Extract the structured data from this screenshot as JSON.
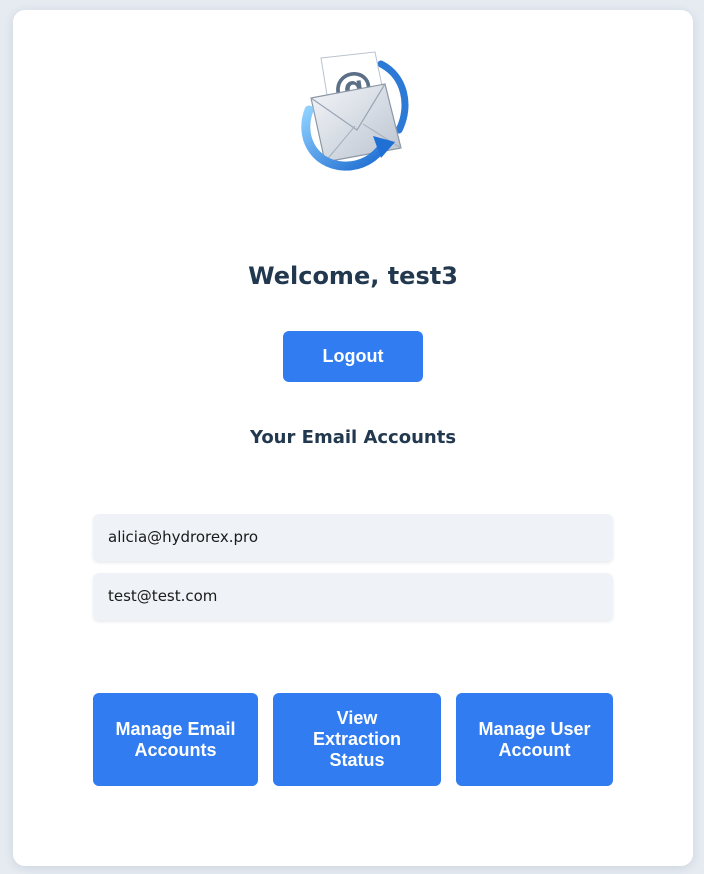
{
  "colors": {
    "background": "#e6ebf2",
    "card": "#ffffff",
    "accent": "#307cf0",
    "heading": "#22384f",
    "account_bg": "#eff3f7"
  },
  "logo": {
    "icon": "email-envelope-icon"
  },
  "welcome": {
    "title": "Welcome, test3"
  },
  "logout": {
    "label": "Logout"
  },
  "accounts_section": {
    "title": "Your Email Accounts",
    "items": [
      {
        "email": "alicia@hydrorex.pro"
      },
      {
        "email": "test@test.com"
      }
    ]
  },
  "actions": {
    "manage_email": "Manage Email Accounts",
    "view_extraction": "View Extraction Status",
    "manage_user": "Manage User Account"
  }
}
